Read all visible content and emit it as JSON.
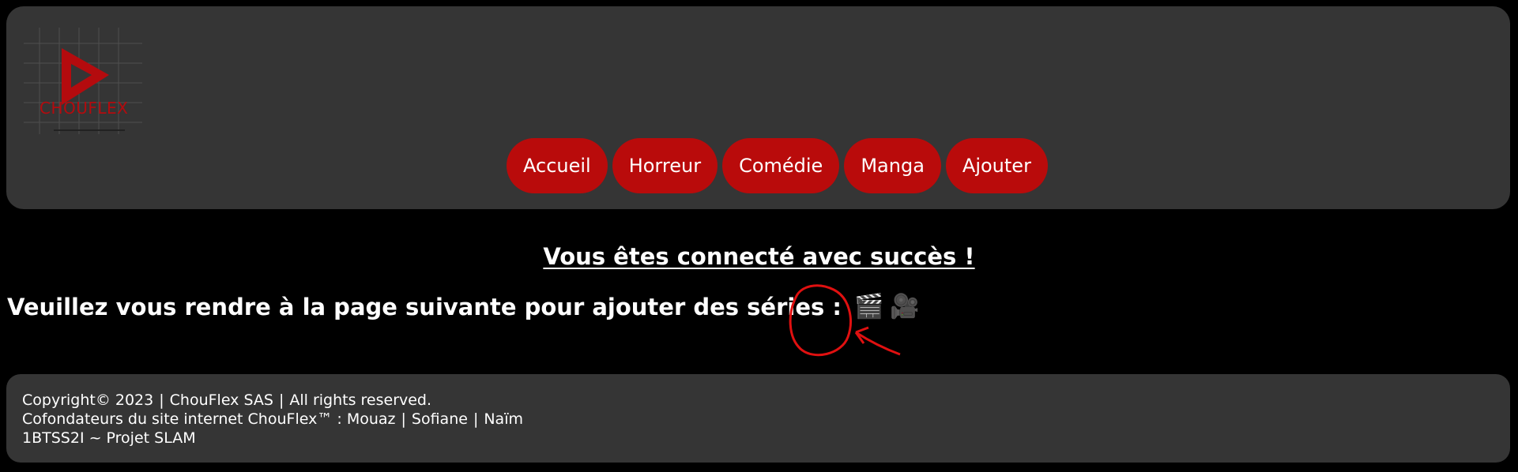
{
  "header": {
    "logo_text": "CHOUFLEX",
    "brand_color": "#b90b0b",
    "nav": [
      {
        "label": "Accueil"
      },
      {
        "label": "Horreur"
      },
      {
        "label": "Comédie"
      },
      {
        "label": "Manga"
      },
      {
        "label": "Ajouter"
      }
    ]
  },
  "main": {
    "success_message": "Vous êtes connecté avec succès !",
    "instruction": "Veuillez vous rendre à la page suivante pour ajouter des séries :",
    "link_icons": [
      "🎬",
      "🎥"
    ],
    "link_icon_names": [
      "clapperboard-icon",
      "movie-camera-icon"
    ],
    "annotation_color": "#e01010"
  },
  "footer": {
    "line1": {
      "copyright": "Copyright© 2023",
      "company": "ChouFlex SAS",
      "rights": "All rights reserved."
    },
    "line2": {
      "prefix": "Cofondateurs du site internet ChouFlex™ :",
      "founders": [
        "Mouaz",
        "Sofiane",
        "Naïm"
      ]
    },
    "line3": "1BTSS2I ~ Projet SLAM"
  }
}
